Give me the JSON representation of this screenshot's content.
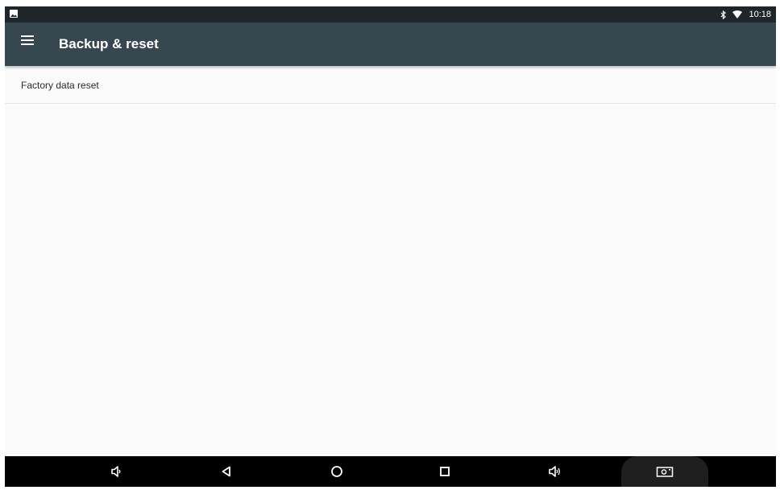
{
  "status_bar": {
    "time": "10:18",
    "icons": [
      "notification-image-icon",
      "bluetooth-icon",
      "wifi-icon"
    ]
  },
  "app_bar": {
    "title": "Backup & reset",
    "menu_icon": "hamburger-menu-icon",
    "background": "#37474f"
  },
  "list": {
    "items": [
      {
        "title": "Factory data reset"
      }
    ]
  },
  "nav_bar": {
    "buttons": [
      "volume-down-icon",
      "back-icon",
      "home-icon",
      "recents-icon",
      "volume-up-icon",
      "screenshot-icon"
    ]
  }
}
